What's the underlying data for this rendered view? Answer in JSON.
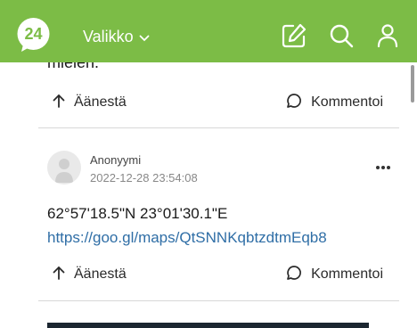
{
  "header": {
    "logo_text": "24",
    "menu_label": "Valikko",
    "icons": [
      "compose-icon",
      "search-icon",
      "user-icon"
    ]
  },
  "prev_post": {
    "partial_text": "mielen.",
    "vote_label": "Äänestä",
    "comment_label": "Kommentoi"
  },
  "post": {
    "author": "Anonyymi",
    "timestamp": "2022-12-28 23:54:08",
    "coords": "62°57'18.5\"N 23°01'30.1\"E",
    "link": "https://goo.gl/maps/QtSNNKqbtzdtmEqb8",
    "vote_label": "Äänestä",
    "comment_label": "Kommentoi"
  },
  "colors": {
    "header_bg": "#7cbc46",
    "link": "#2f6ea6"
  }
}
